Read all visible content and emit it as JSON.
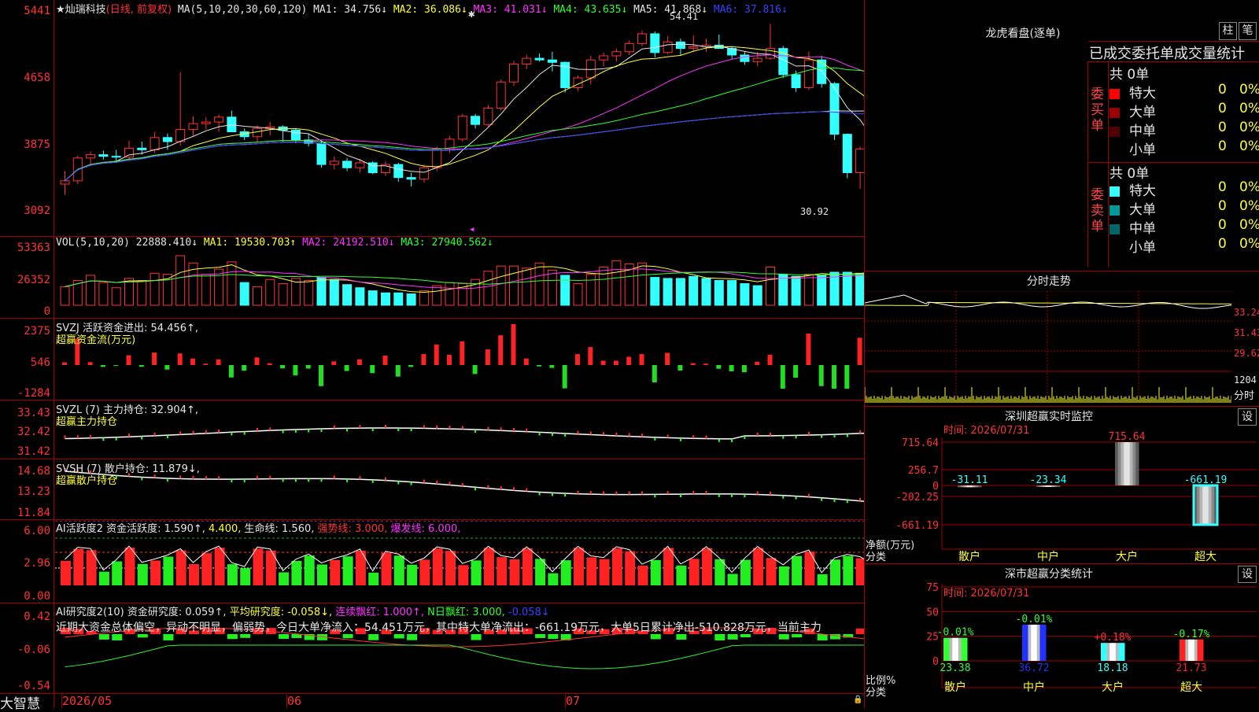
{
  "stock": {
    "name": "★灿瑞科技",
    "mode": "(日线, 前复权)"
  },
  "ma_header": {
    "label": "MA(5,10,20,30,60,120)",
    "items": [
      {
        "text": "MA1: 34.756↓",
        "color": "#e6e6e6"
      },
      {
        "text": "MA2: 36.086↓",
        "color": "#ffff33"
      },
      {
        "text": "MA3: 41.031↓",
        "color": "#ff33ff"
      },
      {
        "text": "MA4: 43.635↓",
        "color": "#33ff33"
      },
      {
        "text": "MA5: 41.868↓",
        "color": "#e6e6e6"
      },
      {
        "text": "MA6: 37.816↓",
        "color": "#3344ff"
      }
    ]
  },
  "price_axis": [
    "5441",
    "4658",
    "3875",
    "3092"
  ],
  "price_annotations": {
    "high": "54.41",
    "low": "30.92"
  },
  "vol_header": {
    "label": "VOL(5,10,20)",
    "items": [
      {
        "text": "22888.410↓",
        "color": "#e6e6e6"
      },
      {
        "text": "MA1: 19530.703↑",
        "color": "#ffff33"
      },
      {
        "text": "MA2: 24192.510↓",
        "color": "#ff33ff"
      },
      {
        "text": "MA3: 27940.562↓",
        "color": "#33ff33"
      }
    ]
  },
  "vol_axis": [
    "53363",
    "26352",
    "0"
  ],
  "svzj": {
    "header": "SVZJ  活跃资金进出: 54.456↑,",
    "sub": "超赢资金流(万元)",
    "axis": [
      "2375",
      "546",
      "-1284"
    ]
  },
  "svzl": {
    "header": "SVZL (7) 主力持仓: 32.904↑,",
    "sub": "超赢主力持仓",
    "axis": [
      "33.43",
      "32.42",
      "31.42"
    ]
  },
  "svsh": {
    "header": "SVSH (7) 散户持仓: 11.879↓,",
    "sub": "超赢散户持仓",
    "axis": [
      "14.68",
      "13.23",
      "11.84"
    ]
  },
  "ai_active": {
    "items": [
      {
        "text": "AI活跃度2 资金活跃度: 1.590↑,",
        "color": "#e6e6e6"
      },
      {
        "text": "4.400,",
        "color": "#ffff33"
      },
      {
        "text": "生命线: 1.560,",
        "color": "#e6e6e6"
      },
      {
        "text": "强势线: 3.000,",
        "color": "#ff3333"
      },
      {
        "text": "爆发线: 6.000,",
        "color": "#ff33ff"
      }
    ],
    "axis": [
      "6.00",
      "2.96",
      "0.00"
    ]
  },
  "ai_research": {
    "items": [
      {
        "text": "AI研究度2(10) 资金研究度: 0.059↑,",
        "color": "#e6e6e6"
      },
      {
        "text": "平均研究度: -0.058↓,",
        "color": "#ffff33"
      },
      {
        "text": "连续飘红: 1.000↑,",
        "color": "#ff33ff"
      },
      {
        "text": "N日飘红: 3.000,",
        "color": "#33ff33"
      },
      {
        "text": "-0.058↓",
        "color": "#3344ff"
      }
    ],
    "comment": "近期大资金总体偏空，异动不明显，偏弱势，今日大单净流入：54.451万元，其中特大单净流出：-661.19万元，大单5日累计净出-510.828万元，当前主力",
    "axis": [
      "0.42",
      "-0.06",
      "-0.54"
    ]
  },
  "date_axis": {
    "brand": "大智慧",
    "labels": [
      "2026/05",
      "06",
      "07"
    ]
  },
  "dragon_tiger": {
    "title": "龙虎看盘(逐单)",
    "btn_bar": "柱",
    "btn_pen": "笔",
    "subtitle": "已成交委托单成交量统计",
    "buy_label": "委买单",
    "sell_label": "委卖单",
    "buy_total": "共 0单",
    "sell_total": "共 0单",
    "buy_rows": [
      {
        "name": "特大",
        "count": "0",
        "pct": "0%",
        "color": "#ff0000"
      },
      {
        "name": "大单",
        "count": "0",
        "pct": "0%",
        "color": "#990000"
      },
      {
        "name": "中单",
        "count": "0",
        "pct": "0%",
        "color": "#550000"
      },
      {
        "name": "小单",
        "count": "0",
        "pct": "0%",
        "color": "#000000"
      }
    ],
    "sell_rows": [
      {
        "name": "特大",
        "count": "0",
        "pct": "0%",
        "color": "#33ffff"
      },
      {
        "name": "大单",
        "count": "0",
        "pct": "0%",
        "color": "#009999"
      },
      {
        "name": "中单",
        "count": "0",
        "pct": "0%",
        "color": "#006666"
      },
      {
        "name": "小单",
        "count": "0",
        "pct": "0%",
        "color": "#000000"
      }
    ]
  },
  "intraday": {
    "title": "分时走势",
    "axis": [
      "33.24",
      "31.43",
      "29.62",
      "1204"
    ],
    "unit": "分时"
  },
  "monitor": {
    "title": "深圳超赢实时监控",
    "btn": "设",
    "time": "时间: 2026/07/31",
    "axis": [
      "715.64",
      "256.7",
      "0",
      "-202.25",
      "-661.19"
    ],
    "left_labels": [
      "净额(万元)",
      "分类"
    ],
    "categories": [
      "散户",
      "中户",
      "大户",
      "超大"
    ],
    "values": [
      -31.11,
      -23.34,
      715.64,
      -661.19
    ],
    "value_labels": [
      "-31.11",
      "-23.34",
      "715.64",
      "-661.19"
    ]
  },
  "classify": {
    "title": "深市超赢分类统计",
    "btn": "设",
    "time": "时间: 2026/07/31",
    "axis": [
      "75",
      "50",
      "25",
      "0"
    ],
    "left_labels": [
      "比例%",
      "分类"
    ],
    "categories": [
      "散户",
      "中户",
      "大户",
      "超大"
    ],
    "values": [
      23.38,
      36.72,
      18.18,
      21.73
    ],
    "value_labels": [
      "23.38",
      "36.72",
      "18.18",
      "21.73"
    ],
    "change_labels": [
      "-0.01%",
      "-0.01%",
      "+0.18%",
      "-0.17%"
    ],
    "colors": [
      "#33ff33",
      "#2233ff",
      "#33ffff",
      "#ff2222"
    ]
  },
  "chart_data": [
    {
      "type": "candlestick",
      "title": "★灿瑞科技 (日线, 前复权)",
      "ylim": [
        30.92,
        54.41
      ],
      "ohlc": [
        [
          34.8,
          36.4,
          33.5,
          35.2
        ],
        [
          35.2,
          38.3,
          34.8,
          38.0
        ],
        [
          38.0,
          38.8,
          37.0,
          38.4
        ],
        [
          38.4,
          38.9,
          37.8,
          38.2
        ],
        [
          38.2,
          39.0,
          37.5,
          38.1
        ],
        [
          38.1,
          40.1,
          37.6,
          39.2
        ],
        [
          39.2,
          40.0,
          38.4,
          39.0
        ],
        [
          39.0,
          41.2,
          38.6,
          40.5
        ],
        [
          40.5,
          41.0,
          39.0,
          40.0
        ],
        [
          40.0,
          48.5,
          39.5,
          41.5
        ],
        [
          41.5,
          43.1,
          40.6,
          42.2
        ],
        [
          42.2,
          43.0,
          41.5,
          42.4
        ],
        [
          42.4,
          43.3,
          41.2,
          43.0
        ],
        [
          43.0,
          43.8,
          42.1,
          41.2
        ],
        [
          41.2,
          41.6,
          40.2,
          40.6
        ],
        [
          40.6,
          42.0,
          40.0,
          41.6
        ],
        [
          41.6,
          42.4,
          40.8,
          41.8
        ],
        [
          41.8,
          42.0,
          40.0,
          41.4
        ],
        [
          41.4,
          41.6,
          39.8,
          40.2
        ],
        [
          40.2,
          40.9,
          39.4,
          39.8
        ],
        [
          39.8,
          40.1,
          36.8,
          37.2
        ],
        [
          37.2,
          38.2,
          36.6,
          37.6
        ],
        [
          37.6,
          38.0,
          36.4,
          36.8
        ],
        [
          36.8,
          37.9,
          36.2,
          37.4
        ],
        [
          37.4,
          37.6,
          36.0,
          36.2
        ],
        [
          36.2,
          37.6,
          35.8,
          37.2
        ],
        [
          37.2,
          37.4,
          35.1,
          35.6
        ],
        [
          35.6,
          36.2,
          34.5,
          35.4
        ],
        [
          35.4,
          37.2,
          35.0,
          36.8
        ],
        [
          36.8,
          39.4,
          36.4,
          39.1
        ],
        [
          39.1,
          40.7,
          38.6,
          40.3
        ],
        [
          40.3,
          43.4,
          40.0,
          43.1
        ],
        [
          43.1,
          43.4,
          41.6,
          42.1
        ],
        [
          42.1,
          44.5,
          41.8,
          44.1
        ],
        [
          44.1,
          47.6,
          43.8,
          47.3
        ],
        [
          47.3,
          49.9,
          46.8,
          49.5
        ],
        [
          49.5,
          50.6,
          48.9,
          50.2
        ],
        [
          50.2,
          50.8,
          49.8,
          50.0
        ],
        [
          50.0,
          51.0,
          48.6,
          49.7
        ],
        [
          49.7,
          49.8,
          46.0,
          46.6
        ],
        [
          46.6,
          48.1,
          46.2,
          47.8
        ],
        [
          47.8,
          50.5,
          47.0,
          50.0
        ],
        [
          50.0,
          50.9,
          49.2,
          50.5
        ],
        [
          50.5,
          51.4,
          49.8,
          51.0
        ],
        [
          51.0,
          52.4,
          50.6,
          52.0
        ],
        [
          52.0,
          53.6,
          51.7,
          53.2
        ],
        [
          53.2,
          53.5,
          50.3,
          50.9
        ],
        [
          50.9,
          52.9,
          50.7,
          52.2
        ],
        [
          52.2,
          52.6,
          50.5,
          51.4
        ],
        [
          51.4,
          53.0,
          51.0,
          51.6
        ],
        [
          51.6,
          52.6,
          51.0,
          51.8
        ],
        [
          51.8,
          53.1,
          51.4,
          51.4
        ],
        [
          51.4,
          51.6,
          50.1,
          50.6
        ],
        [
          50.6,
          51.0,
          49.4,
          49.8
        ],
        [
          49.8,
          51.0,
          49.2,
          50.2
        ],
        [
          50.2,
          54.41,
          50.0,
          51.4
        ],
        [
          51.4,
          51.7,
          47.8,
          48.2
        ],
        [
          48.2,
          48.7,
          46.1,
          46.6
        ],
        [
          46.6,
          51.0,
          46.3,
          50.0
        ],
        [
          50.0,
          50.5,
          46.6,
          47.1
        ],
        [
          47.1,
          47.3,
          40.2,
          40.9
        ],
        [
          40.9,
          41.0,
          35.5,
          36.2
        ],
        [
          36.2,
          39.4,
          34.2,
          39.1
        ],
        [
          39.1,
          40.0,
          37.8,
          38.6
        ],
        [
          38.6,
          39.4,
          37.7,
          38.9
        ],
        [
          38.9,
          39.3,
          37.6,
          37.9
        ],
        [
          37.9,
          38.9,
          37.1,
          38.7
        ],
        [
          38.7,
          39.0,
          36.8,
          37.0
        ],
        [
          37.0,
          37.5,
          35.2,
          35.6
        ],
        [
          35.6,
          36.1,
          33.1,
          33.6
        ],
        [
          33.6,
          34.0,
          30.92,
          32.1
        ],
        [
          32.1,
          34.6,
          31.8,
          34.2
        ]
      ]
    },
    {
      "type": "bar",
      "title": "VOL(5,10,20)",
      "ylim": [
        0,
        53363
      ],
      "up": [
        true,
        true,
        true,
        true,
        true,
        true,
        true,
        true,
        true,
        true,
        true,
        true,
        true,
        true,
        false,
        true,
        true,
        true,
        true,
        true,
        false,
        false,
        false,
        false,
        false,
        false,
        false,
        false,
        true,
        true,
        true,
        true,
        true,
        true,
        true,
        true,
        true,
        true,
        true,
        false,
        true,
        true,
        true,
        true,
        true,
        true,
        false,
        false,
        false,
        false,
        false,
        false,
        false,
        false,
        false,
        true,
        false,
        false,
        true,
        false,
        false,
        false,
        false,
        true,
        false,
        false,
        true,
        false,
        false,
        false,
        false,
        true
      ],
      "values": [
        18000,
        24000,
        29000,
        22000,
        17000,
        26000,
        24000,
        31000,
        30000,
        48000,
        41000,
        30000,
        35000,
        42000,
        22000,
        18000,
        25000,
        21000,
        26000,
        24000,
        27000,
        25000,
        20000,
        17000,
        14000,
        12000,
        12000,
        11000,
        14000,
        19000,
        22000,
        21000,
        25000,
        33000,
        38000,
        38000,
        36000,
        41000,
        34000,
        29000,
        21000,
        30000,
        37000,
        43000,
        40000,
        41000,
        27000,
        26000,
        26000,
        28000,
        26000,
        24000,
        24000,
        21000,
        19000,
        37000,
        30000,
        28000,
        30000,
        29000,
        32000,
        32000,
        31000,
        38000,
        43000,
        38000,
        35000,
        15000,
        14000,
        16000,
        22000,
        23000
      ]
    }
  ]
}
